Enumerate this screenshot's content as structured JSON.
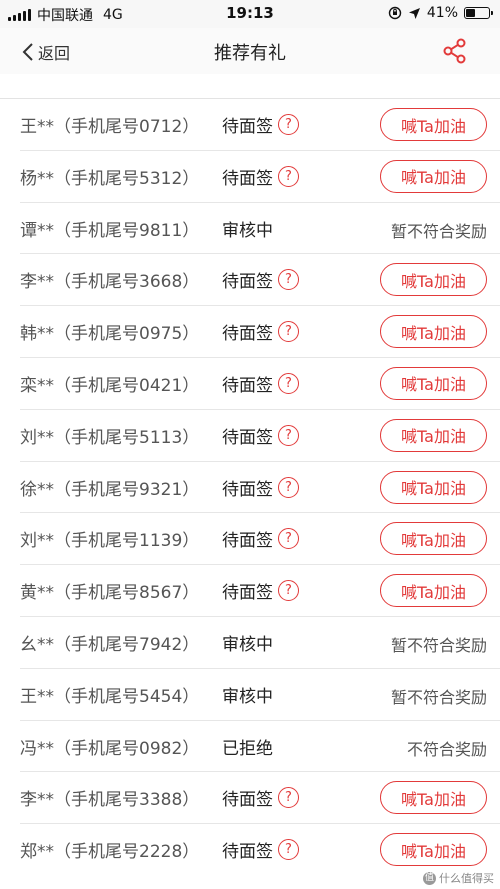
{
  "status_bar": {
    "carrier": "中国联通",
    "network": "4G",
    "time": "19:13",
    "battery_text": "41%",
    "battery_level": 0.41
  },
  "nav": {
    "back_label": "返回",
    "title": "推荐有礼",
    "share_icon": "share-icon"
  },
  "help_symbol": "?",
  "colors": {
    "accent": "#e23a3a"
  },
  "rows": [
    {
      "name": "王**（手机尾号0712）",
      "status": "待面签",
      "help": true,
      "action": "喊Ta加油",
      "note": ""
    },
    {
      "name": "杨**（手机尾号5312）",
      "status": "待面签",
      "help": true,
      "action": "喊Ta加油",
      "note": ""
    },
    {
      "name": "谭**（手机尾号9811）",
      "status": "审核中",
      "help": false,
      "action": "",
      "note": "暂不符合奖励"
    },
    {
      "name": "李**（手机尾号3668）",
      "status": "待面签",
      "help": true,
      "action": "喊Ta加油",
      "note": ""
    },
    {
      "name": "韩**（手机尾号0975）",
      "status": "待面签",
      "help": true,
      "action": "喊Ta加油",
      "note": ""
    },
    {
      "name": "栾**（手机尾号0421）",
      "status": "待面签",
      "help": true,
      "action": "喊Ta加油",
      "note": ""
    },
    {
      "name": "刘**（手机尾号5113）",
      "status": "待面签",
      "help": true,
      "action": "喊Ta加油",
      "note": ""
    },
    {
      "name": "徐**（手机尾号9321）",
      "status": "待面签",
      "help": true,
      "action": "喊Ta加油",
      "note": ""
    },
    {
      "name": "刘**（手机尾号1139）",
      "status": "待面签",
      "help": true,
      "action": "喊Ta加油",
      "note": ""
    },
    {
      "name": "黄**（手机尾号8567）",
      "status": "待面签",
      "help": true,
      "action": "喊Ta加油",
      "note": ""
    },
    {
      "name": "幺**（手机尾号7942）",
      "status": "审核中",
      "help": false,
      "action": "",
      "note": "暂不符合奖励"
    },
    {
      "name": "王**（手机尾号5454）",
      "status": "审核中",
      "help": false,
      "action": "",
      "note": "暂不符合奖励"
    },
    {
      "name": "冯**（手机尾号0982）",
      "status": "已拒绝",
      "help": false,
      "action": "",
      "note": "不符合奖励"
    },
    {
      "name": "李**（手机尾号3388）",
      "status": "待面签",
      "help": true,
      "action": "喊Ta加油",
      "note": ""
    },
    {
      "name": "郑**（手机尾号2228）",
      "status": "待面签",
      "help": true,
      "action": "喊Ta加油",
      "note": ""
    }
  ],
  "watermark": {
    "text": "什么值得买",
    "logo": "值"
  }
}
